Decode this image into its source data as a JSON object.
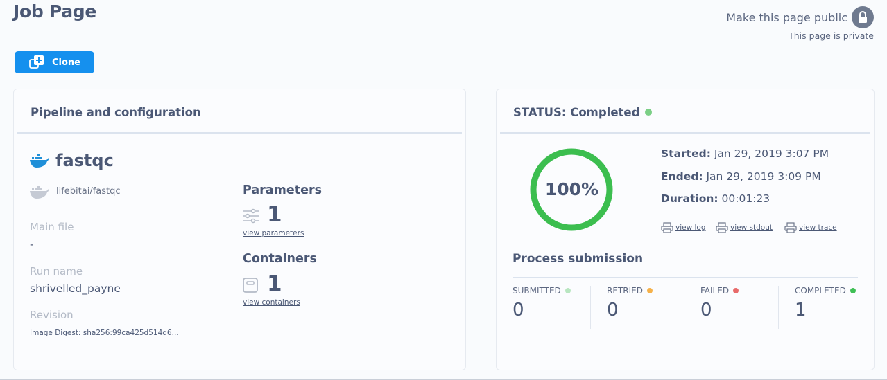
{
  "header": {
    "title": "Job Page",
    "public_label": "Make this page public",
    "private_note": "This page is private"
  },
  "toolbar": {
    "clone_label": "Clone"
  },
  "pipeline": {
    "section_title": "Pipeline and configuration",
    "name": "fastqc",
    "image": "lifebitai/fastqc",
    "main_file_label": "Main file",
    "main_file_value": "-",
    "run_name_label": "Run name",
    "run_name_value": "shrivelled_payne",
    "revision_label": "Revision",
    "image_digest": "Image Digest: sha256:99ca425d514d6...",
    "parameters_title": "Parameters",
    "parameters_count": "1",
    "view_parameters": "view parameters",
    "containers_title": "Containers",
    "containers_count": "1",
    "view_containers": "view containers"
  },
  "status": {
    "title": "STATUS: Completed",
    "progress_text": "100%",
    "progress_fraction": 1.0,
    "started_label": "Started:",
    "started_value": "Jan 29, 2019 3:07 PM",
    "ended_label": "Ended:",
    "ended_value": "Jan 29, 2019 3:09 PM",
    "duration_label": "Duration:",
    "duration_value": "00:01:23",
    "links": [
      "view log",
      "view stdout",
      "view trace"
    ],
    "process_title": "Process submission",
    "stats": [
      {
        "label": "SUBMITTED",
        "value": "0",
        "color": "#b8e6c0"
      },
      {
        "label": "RETRIED",
        "value": "0",
        "color": "#f5b14a"
      },
      {
        "label": "FAILED",
        "value": "0",
        "color": "#e86a6a"
      },
      {
        "label": "COMPLETED",
        "value": "1",
        "color": "#3fbf55"
      }
    ]
  },
  "colors": {
    "accent": "#1590ee",
    "ring": "#3cbe4f",
    "completed_dot": "#7bcf86"
  }
}
